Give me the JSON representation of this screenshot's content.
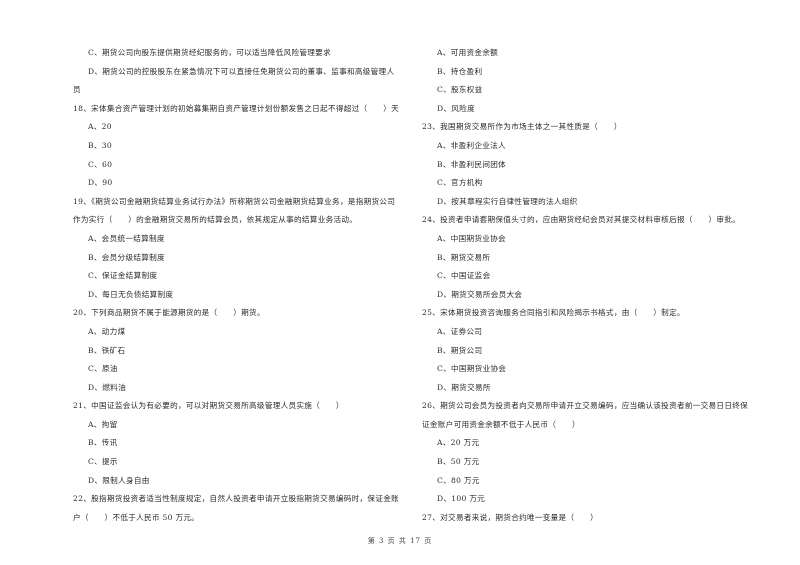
{
  "left_column": [
    {
      "type": "opt",
      "text": "C、期货公司向股东提供期货经纪服务的，可以适当降低风险管理要求"
    },
    {
      "type": "opt",
      "text": "D、期货公司的控股股东在紧急情况下可以直接任免期货公司的董事、监事和高级管理人"
    },
    {
      "type": "q",
      "text": "员"
    },
    {
      "type": "q",
      "text": "18、宋体集合资产管理计划的初始募集期自资产管理计划份额发售之日起不得超过（　　）天"
    },
    {
      "type": "opt",
      "text": "A、20"
    },
    {
      "type": "opt",
      "text": "B、30"
    },
    {
      "type": "opt",
      "text": "C、60"
    },
    {
      "type": "opt",
      "text": "D、90"
    },
    {
      "type": "q",
      "text": "19、《期货公司金融期货结算业务试行办法》所称期货公司金融期货结算业务，是指期货公司"
    },
    {
      "type": "q",
      "text": "作为实行（　　）的金融期货交易所的结算会员，依其规定从事的结算业务活动。"
    },
    {
      "type": "opt",
      "text": "A、会员统一结算制度"
    },
    {
      "type": "opt",
      "text": "B、会员分级结算制度"
    },
    {
      "type": "opt",
      "text": "C、保证金结算制度"
    },
    {
      "type": "opt",
      "text": "D、每日无负债结算制度"
    },
    {
      "type": "q",
      "text": "20、下列商品期货不属于能源期货的是（　　）期货。"
    },
    {
      "type": "opt",
      "text": "A、动力煤"
    },
    {
      "type": "opt",
      "text": "B、铁矿石"
    },
    {
      "type": "opt",
      "text": "C、原油"
    },
    {
      "type": "opt",
      "text": "D、燃料油"
    },
    {
      "type": "q",
      "text": "21、中国证监会认为有必要的，可以对期货交易所高级管理人员实施（　　）"
    },
    {
      "type": "opt",
      "text": "A、拘留"
    },
    {
      "type": "opt",
      "text": "B、传讯"
    },
    {
      "type": "opt",
      "text": "C、提示"
    },
    {
      "type": "opt",
      "text": "D、限制人身自由"
    },
    {
      "type": "q",
      "text": "22、股指期货投资者适当性制度规定，自然人投资者申请开立股指期货交易编码时，保证金账"
    },
    {
      "type": "q",
      "text": "户（　　）不低于人民币 50 万元。"
    }
  ],
  "right_column": [
    {
      "type": "opt",
      "text": "A、可用资金余额"
    },
    {
      "type": "opt",
      "text": "B、持仓盈利"
    },
    {
      "type": "opt",
      "text": "C、股东权益"
    },
    {
      "type": "opt",
      "text": "D、风险度"
    },
    {
      "type": "q",
      "text": "23、我国期货交易所作为市场主体之一其性质是（　　）"
    },
    {
      "type": "opt",
      "text": "A、非盈利企业法人"
    },
    {
      "type": "opt",
      "text": "B、非盈利民间团体"
    },
    {
      "type": "opt",
      "text": "C、官方机构"
    },
    {
      "type": "opt",
      "text": "D、按其章程实行自律性管理的法人组织"
    },
    {
      "type": "q",
      "text": "24、投资者申请套期保值头寸的，应由期货经纪会员对其提交材料审核后报（　　）审批。"
    },
    {
      "type": "opt",
      "text": "A、中国期货业协会"
    },
    {
      "type": "opt",
      "text": "B、期货交易所"
    },
    {
      "type": "opt",
      "text": "C、中国证监会"
    },
    {
      "type": "opt",
      "text": "D、期货交易所会员大会"
    },
    {
      "type": "q",
      "text": "25、宋体期货投资咨询服务合同指引和风险揭示书格式，由（　　）制定。"
    },
    {
      "type": "opt",
      "text": "A、证券公司"
    },
    {
      "type": "opt",
      "text": "B、期货公司"
    },
    {
      "type": "opt",
      "text": "C、中国期货业协会"
    },
    {
      "type": "opt",
      "text": "D、期货交易所"
    },
    {
      "type": "q",
      "text": "26、期货公司会员为投资者向交易所申请开立交易编码，应当确认该投资者前一交易日日终保"
    },
    {
      "type": "q",
      "text": "证金账户可用资金余额不低于人民币（　　）"
    },
    {
      "type": "opt",
      "text": "A、20 万元"
    },
    {
      "type": "opt",
      "text": "B、50 万元"
    },
    {
      "type": "opt",
      "text": "C、80 万元"
    },
    {
      "type": "opt",
      "text": "D、100 万元"
    },
    {
      "type": "q",
      "text": "27、对交易者来说，期货合约唯一变量是（　　）"
    }
  ],
  "footer": {
    "page_label": "第 3 页 共 17 页"
  }
}
